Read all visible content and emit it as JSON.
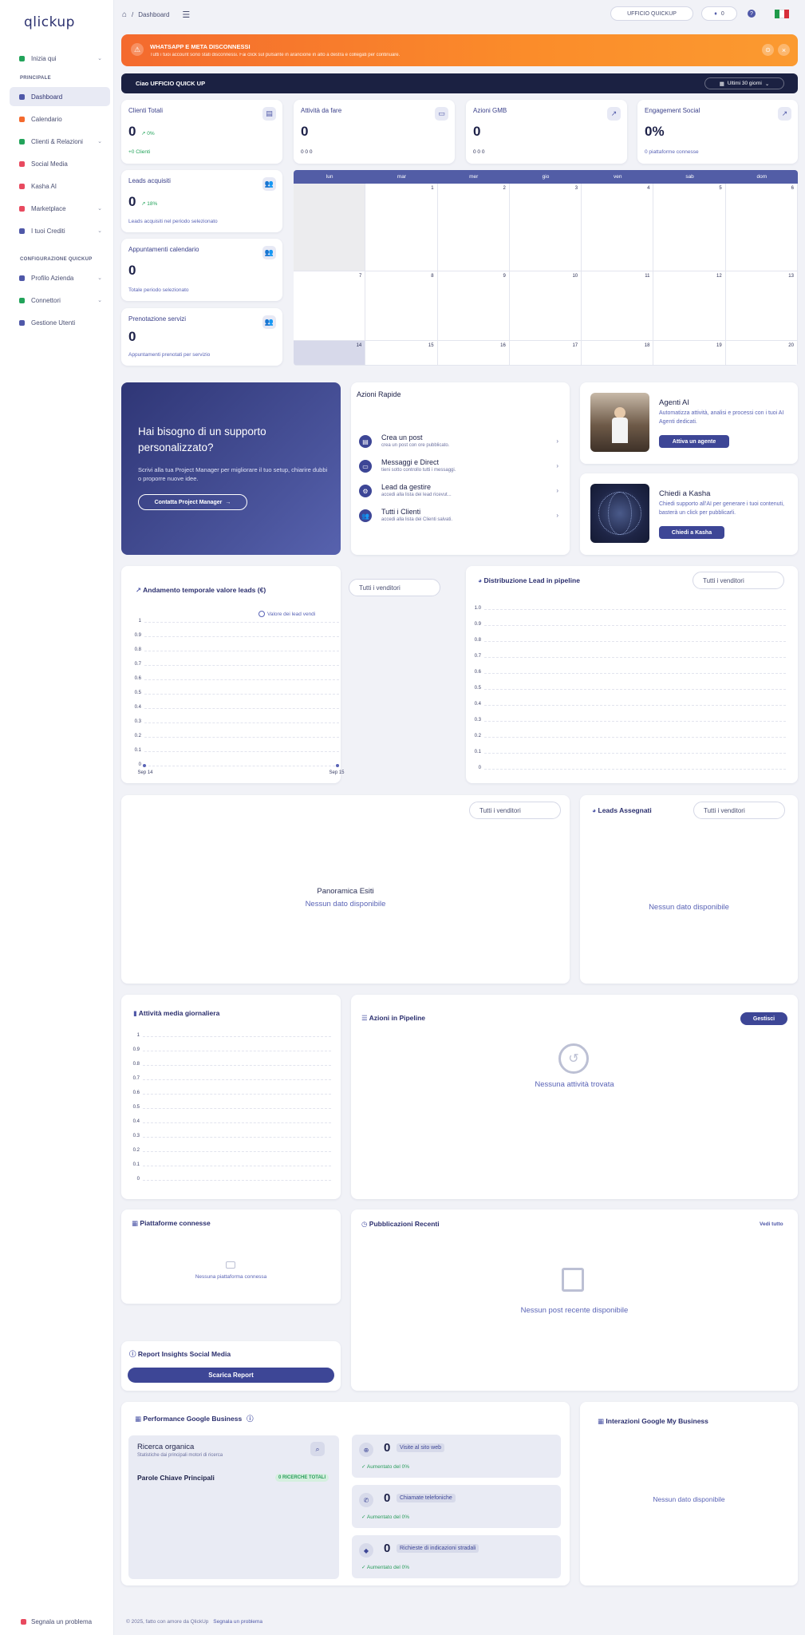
{
  "sidebar": {
    "logo": "qlickup",
    "top_item": "Inizia qui",
    "section_main": "PRINCIPALE",
    "items_main": [
      {
        "label": "Dashboard",
        "color": "#4f58a8"
      },
      {
        "label": "Calendario",
        "color": "#f46a2e"
      },
      {
        "label": "Clienti & Relazioni",
        "color": "#22a35a"
      },
      {
        "label": "Social Media",
        "color": "#e84a5f"
      },
      {
        "label": "Kasha AI",
        "color": "#e84a5f"
      },
      {
        "label": "Marketplace",
        "color": "#e84a5f"
      },
      {
        "label": "I tuoi Crediti",
        "color": "#4f58a8"
      }
    ],
    "section_config": "CONFIGURAZIONE QUICKUP",
    "items_config": [
      {
        "label": "Profilo Azienda",
        "color": "#4f58a8"
      },
      {
        "label": "Connettori",
        "color": "#22a35a"
      },
      {
        "label": "Gestione Utenti",
        "color": "#4f58a8"
      }
    ],
    "footer": "Segnala un problema"
  },
  "topbar": {
    "breadcrumb_sep": "/",
    "breadcrumb": "Dashboard",
    "office": "UFFICIO QUICKUP",
    "credits": "0"
  },
  "alert": {
    "title": "WHATSAPP E META DISCONNESSI",
    "text": "Tutti i tuoi account sono stati disconnessi. Fai click sul pulsante in arancione in alto a destra e collegati per continuare."
  },
  "greeting": {
    "text": "Ciao UFFICIO QUICK UP",
    "range": "Ultimi 30 giorni"
  },
  "stats": [
    {
      "title": "Clienti Totali",
      "value": "0",
      "delta": "0%",
      "sub": "+0 Clienti"
    },
    {
      "title": "Attività da fare",
      "value": "0",
      "sub": "0  0  0"
    },
    {
      "title": "Azioni GMB",
      "value": "0",
      "sub": "0  0  0"
    },
    {
      "title": "Engagement Social",
      "value": "0%",
      "sub": "0 piattaforme connesse"
    }
  ],
  "side_stats": [
    {
      "title": "Leads acquisiti",
      "value": "0",
      "delta": "18%",
      "sub": "Leads acquisiti nel periodo selezionato"
    },
    {
      "title": "Appuntamenti calendario",
      "value": "0",
      "sub": "Totale periodo selezionato"
    },
    {
      "title": "Prenotazione servizi",
      "value": "0",
      "sub": "Appuntamenti prenotati per servizio"
    }
  ],
  "calendar": {
    "days": [
      "lun",
      "mar",
      "mer",
      "gio",
      "ven",
      "sab",
      "dom"
    ],
    "week1": [
      "",
      "1",
      "2",
      "3",
      "4",
      "5",
      "6"
    ],
    "week2": [
      "7",
      "8",
      "9",
      "10",
      "11",
      "12",
      "13"
    ],
    "week3": [
      "14",
      "15",
      "16",
      "17",
      "18",
      "19",
      "20"
    ]
  },
  "support": {
    "title": "Hai bisogno di un supporto personalizzato?",
    "text": "Scrivi alla tua Project Manager per migliorare il tuo setup, chiarire dubbi o proporre nuove idee.",
    "button": "Contatta Project Manager"
  },
  "quick_actions": {
    "title": "Azioni Rapide",
    "items": [
      {
        "title": "Crea un post",
        "sub": "crea un post con ore pubblicato."
      },
      {
        "title": "Messaggi e Direct",
        "sub": "tieni sotto controllo tutti i messaggi."
      },
      {
        "title": "Lead da gestire",
        "sub": "accedi alla lista dei lead ricevut..."
      },
      {
        "title": "Tutti i Clienti",
        "sub": "accedi alla lista dei Clienti salvati."
      }
    ]
  },
  "ai_agents": {
    "title": "Agenti AI",
    "text": "Automatizza attività, analisi e processi con i tuoi AI Agenti dedicati.",
    "button": "Attiva un agente"
  },
  "kasha": {
    "title": "Chiedi a Kasha",
    "text": "Chiedi supporto all'AI per generare i tuoi contenuti, basterà un click per pubblicarli.",
    "button": "Chiedi a Kasha"
  },
  "line_chart": {
    "title": "Andamento temporale valore leads (€)",
    "dropdown": "Tutti i venditori",
    "legend": "Valore dei lead vendi"
  },
  "pipeline_chart": {
    "title": "Distribuzione Lead in pipeline",
    "dropdown": "Tutti i venditori"
  },
  "esiti": {
    "dropdown": "Tutti i venditori",
    "title": "Panoramica Esiti",
    "empty": "Nessun dato disponibile"
  },
  "assigned": {
    "title": "Leads Assegnati",
    "dropdown": "Tutti i venditori",
    "empty": "Nessun dato disponibile"
  },
  "activity_chart": {
    "title": "Attività media giornaliera"
  },
  "pipeline_actions": {
    "title": "Azioni in Pipeline",
    "button": "Gestisci",
    "empty": "Nessuna attività trovata"
  },
  "platforms": {
    "title": "Piattaforme connesse",
    "empty": "Nessuna piattaforma connessa"
  },
  "publications": {
    "title": "Pubblicazioni Recenti",
    "link": "Vedi tutto",
    "empty": "Nessun post recente disponibile"
  },
  "report": {
    "title": "Report Insights Social Media",
    "button": "Scarica Report"
  },
  "gbusiness": {
    "title": "Performance Google Business",
    "organic_title": "Ricerca organica",
    "organic_sub": "Statistiche dai principali motori di ricerca",
    "keywords": "Parole Chiave Principali",
    "keywords_badge": "0 RICERCHE TOTALI",
    "metrics": [
      {
        "value": "0",
        "label": "Visite al sito web",
        "sub": "Aumentato del 0%"
      },
      {
        "value": "0",
        "label": "Chiamate telefoniche",
        "sub": "Aumentato del 0%"
      },
      {
        "value": "0",
        "label": "Richieste di indicazioni stradali",
        "sub": "Aumentato del 0%"
      }
    ]
  },
  "gmb_interactions": {
    "title": "Interazioni Google My Business",
    "empty": "Nessun dato disponibile"
  },
  "footer": {
    "copyright": "© 2025, fatto con amore da QlickUp",
    "link": "Segnala un problema"
  },
  "chart_data": [
    {
      "type": "line",
      "title": "Andamento temporale valore leads (€)",
      "x": [
        "Sep 14",
        "Sep 15"
      ],
      "series": [
        {
          "name": "Valore dei lead vendi",
          "values": [
            0,
            0
          ]
        }
      ],
      "yticks": [
        "0",
        "0.1",
        "0.2",
        "0.3",
        "0.4",
        "0.5",
        "0.6",
        "0.7",
        "0.8",
        "0.9",
        "1"
      ],
      "ylim": [
        0,
        1
      ]
    },
    {
      "type": "bar",
      "title": "Distribuzione Lead in pipeline",
      "categories": [],
      "values": [],
      "yticks": [
        "0",
        "0.1",
        "0.2",
        "0.3",
        "0.4",
        "0.5",
        "0.6",
        "0.7",
        "0.8",
        "0.9",
        "1.0"
      ],
      "ylim": [
        0,
        1
      ]
    },
    {
      "type": "bar",
      "title": "Attività media giornaliera",
      "categories": [],
      "values": [],
      "yticks": [
        "0",
        "0.1",
        "0.2",
        "0.3",
        "0.4",
        "0.5",
        "0.6",
        "0.7",
        "0.8",
        "0.9",
        "1"
      ],
      "ylim": [
        0,
        1
      ]
    }
  ]
}
